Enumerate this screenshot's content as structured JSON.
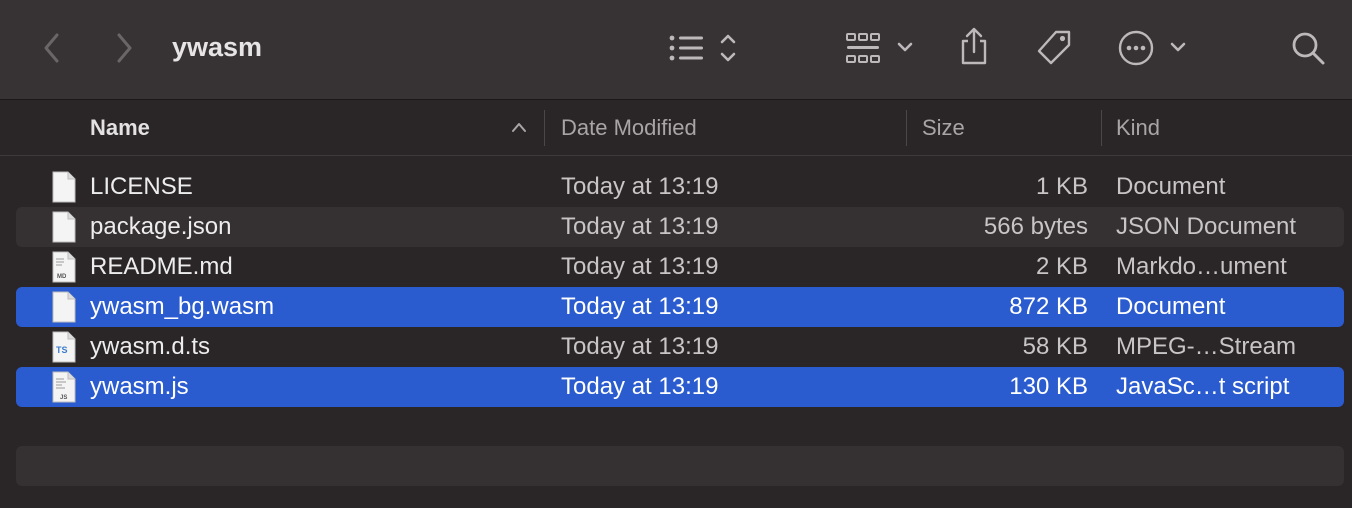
{
  "window": {
    "title": "ywasm"
  },
  "toolbar": {
    "back_icon": "chevron-left-icon",
    "forward_icon": "chevron-right-icon",
    "view_icon": "list-view-icon",
    "group_icon": "grid-group-icon",
    "share_icon": "share-icon",
    "tag_icon": "tag-icon",
    "more_icon": "ellipsis-circle-icon",
    "search_icon": "search-icon"
  },
  "columns": {
    "name": "Name",
    "date": "Date Modified",
    "size": "Size",
    "kind": "Kind"
  },
  "files": [
    {
      "name": "LICENSE",
      "date": "Today at 13:19",
      "size": "1 KB",
      "kind": "Document",
      "icon": "document-icon",
      "selected": false
    },
    {
      "name": "package.json",
      "date": "Today at 13:19",
      "size": "566 bytes",
      "kind": "JSON Document",
      "icon": "document-icon",
      "selected": false
    },
    {
      "name": "README.md",
      "date": "Today at 13:19",
      "size": "2 KB",
      "kind": "Markdo…ument",
      "icon": "markdown-file-icon",
      "selected": false
    },
    {
      "name": "ywasm_bg.wasm",
      "date": "Today at 13:19",
      "size": "872 KB",
      "kind": "Document",
      "icon": "document-icon",
      "selected": true
    },
    {
      "name": "ywasm.d.ts",
      "date": "Today at 13:19",
      "size": "58 KB",
      "kind": "MPEG-…Stream",
      "icon": "typescript-file-icon",
      "selected": false
    },
    {
      "name": "ywasm.js",
      "date": "Today at 13:19",
      "size": "130 KB",
      "kind": "JavaSc…t script",
      "icon": "javascript-file-icon",
      "selected": true
    }
  ],
  "colors": {
    "selection": "#2a5bcf",
    "toolbar": "#373234",
    "background": "#2a2527"
  }
}
